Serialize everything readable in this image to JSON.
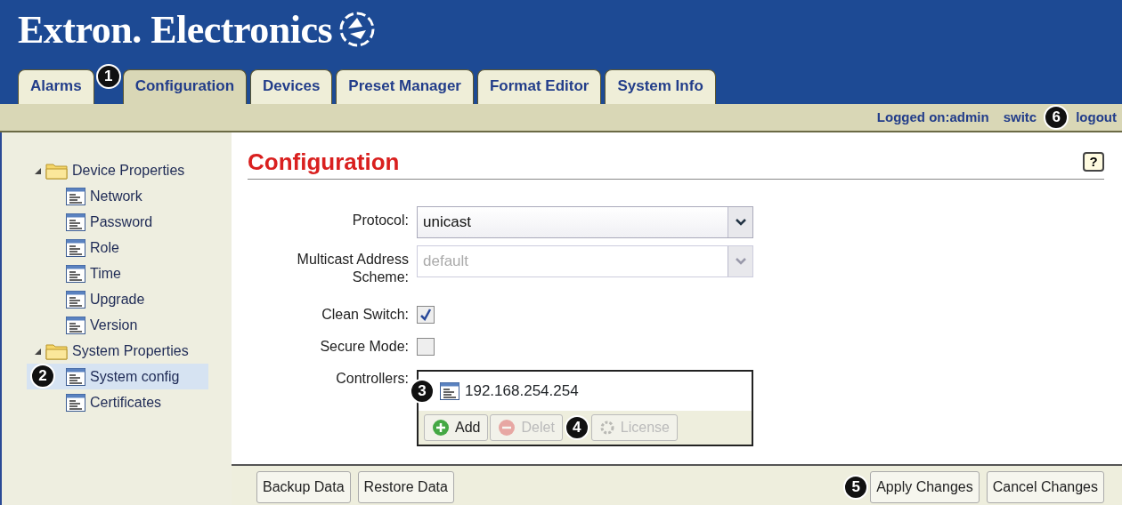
{
  "header": {
    "logo": "Extron. Electronics"
  },
  "tabs": [
    {
      "label": "Alarms",
      "selected": false
    },
    {
      "label": "Configuration",
      "selected": true,
      "callout": "1"
    },
    {
      "label": "Devices",
      "selected": false
    },
    {
      "label": "Preset Manager",
      "selected": false
    },
    {
      "label": "Format Editor",
      "selected": false
    },
    {
      "label": "System Info",
      "selected": false
    }
  ],
  "user_bar": {
    "logged_on": "Logged on:admin",
    "switch_link": "switc",
    "switch_callout": "6",
    "logout": "logout"
  },
  "sidebar": {
    "items": [
      {
        "label": "Device Properties",
        "expanded": true,
        "children": [
          {
            "label": "Network",
            "selected": false
          },
          {
            "label": "Password",
            "selected": false
          },
          {
            "label": "Role",
            "selected": false
          },
          {
            "label": "Time",
            "selected": false
          },
          {
            "label": "Upgrade",
            "selected": false
          },
          {
            "label": "Version",
            "selected": false
          }
        ]
      },
      {
        "label": "System Properties",
        "expanded": true,
        "children": [
          {
            "label": "System config",
            "selected": true,
            "callout": "2"
          },
          {
            "label": "Certificates",
            "selected": false
          }
        ]
      }
    ]
  },
  "page": {
    "title": "Configuration",
    "help": "?"
  },
  "form": [
    {
      "kind": "select",
      "label": "Protocol:",
      "value": "unicast",
      "disabled": false
    },
    {
      "kind": "select",
      "label": "Multicast Address Scheme:",
      "value": "default",
      "disabled": true
    },
    {
      "kind": "checkbox",
      "label": "Clean Switch:",
      "checked": true
    },
    {
      "kind": "checkbox",
      "label": "Secure Mode:",
      "checked": false
    },
    {
      "kind": "list",
      "label": "Controllers:",
      "items": [
        {
          "text": "192.168.254.254",
          "callout": "3"
        }
      ],
      "buttons": [
        {
          "label": "Add",
          "disabled": false
        },
        {
          "label": "Delet",
          "disabled": true,
          "callout": "4"
        },
        {
          "label": "License",
          "disabled": true
        }
      ]
    }
  ],
  "footer": {
    "left_buttons": [
      {
        "label": "Backup Data"
      },
      {
        "label": "Restore Data"
      }
    ],
    "right_buttons": [
      {
        "label": "Apply Changes",
        "callout": "5"
      },
      {
        "label": "Cancel Changes"
      }
    ]
  }
}
